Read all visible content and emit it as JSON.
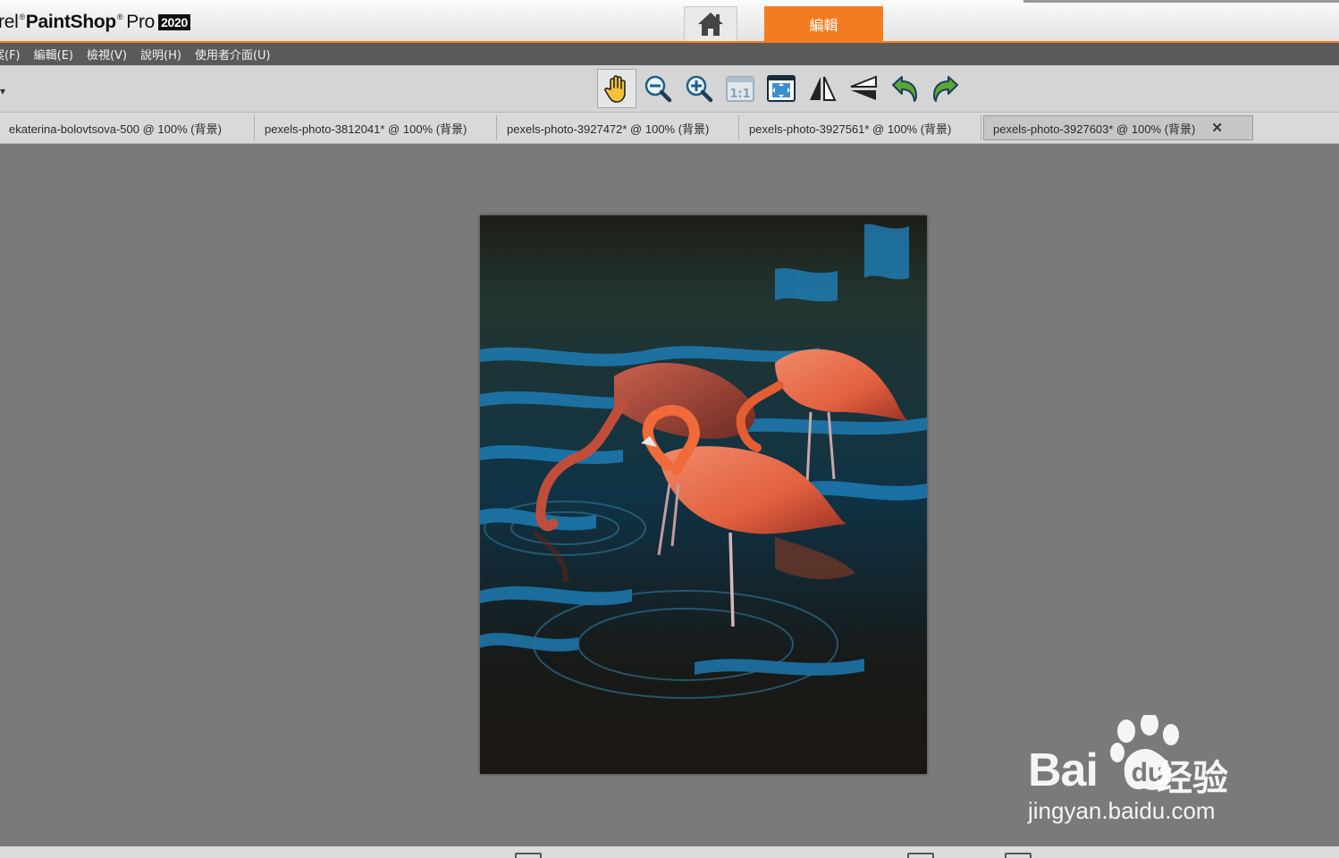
{
  "app": {
    "brand_prefix": "rel",
    "brand_name": "PaintShop",
    "brand_suffix": "Pro",
    "brand_year": "2020"
  },
  "top_tabs": {
    "home_icon": "home-icon",
    "edit_label": "編輯"
  },
  "menu": [
    "案(F)",
    "編輯(E)",
    "檢視(V)",
    "說明(H)",
    "使用者介面(U)"
  ],
  "toolbar": {
    "left_mark": "▾",
    "tools": [
      {
        "name": "pan-tool",
        "icon": "hand-icon",
        "active": true
      },
      {
        "name": "zoom-out",
        "icon": "zoom-out-icon"
      },
      {
        "name": "zoom-in",
        "icon": "zoom-in-icon"
      },
      {
        "name": "actual-size",
        "icon": "one-to-one-icon",
        "label": "1:1"
      },
      {
        "name": "fit-window",
        "icon": "fit-window-icon"
      },
      {
        "name": "flip-horizontal",
        "icon": "flip-horizontal-icon"
      },
      {
        "name": "flip-vertical",
        "icon": "flip-vertical-icon"
      },
      {
        "name": "undo",
        "icon": "undo-icon"
      },
      {
        "name": "redo",
        "icon": "redo-icon"
      }
    ]
  },
  "doc_tabs": [
    {
      "label": "ekaterina-bolovtsova-500  @  100%  (背景)"
    },
    {
      "label": "pexels-photo-3812041*  @  100%  (背景)"
    },
    {
      "label": "pexels-photo-3927472*  @  100%  (背景)"
    },
    {
      "label": "pexels-photo-3927561*  @  100%  (背景)"
    },
    {
      "label": "pexels-photo-3927603*  @  100%  (背景)",
      "active": true,
      "close": "✕"
    }
  ],
  "canvas": {
    "image_subject": "flamingos-in-water-photo"
  },
  "watermark": {
    "brand": "Bai",
    "paw_text": "du",
    "cn": "经验",
    "url": "jingyan.baidu.com"
  },
  "colors": {
    "accent": "#f47c20",
    "menubar": "#5a5a5a",
    "workspace": "#7a7a7a"
  }
}
